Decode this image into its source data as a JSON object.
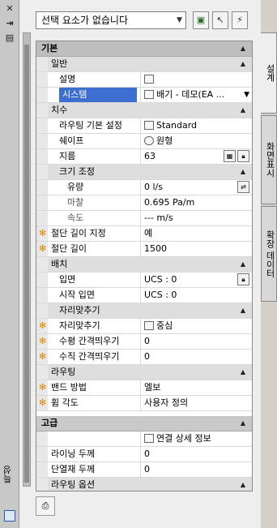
{
  "toolbar": {
    "selection": "선택 요소가 없습니다"
  },
  "side": {
    "title": "특성"
  },
  "tabs": [
    {
      "label": "설계"
    },
    {
      "label": "화면표시"
    },
    {
      "label": "확장 데이터"
    }
  ],
  "groups": {
    "basic": "기본",
    "general": "일반",
    "dimensions": "치수",
    "size_adjust": "크기 조정",
    "placement": "배치",
    "justification": "자리맞추기",
    "routing": "라우팅",
    "advanced": "고급",
    "routing_options": "라우팅 옵션"
  },
  "props": {
    "description": {
      "label": "설명",
      "value": ""
    },
    "system": {
      "label": "시스템",
      "value": "배기 - 데모(EA ..."
    },
    "routing_pref": {
      "label": "라우팅 기본 설정",
      "value": "Standard"
    },
    "shape": {
      "label": "쉐이프",
      "value": "원형"
    },
    "diameter": {
      "label": "지름",
      "value": "63"
    },
    "flow": {
      "label": "유량",
      "value": "0 l/s"
    },
    "friction": {
      "label": "마찰",
      "value": "0.695 Pa/m"
    },
    "velocity": {
      "label": "속도",
      "value": "--- m/s"
    },
    "cut_length_spec": {
      "label": "절단 길이 지정",
      "value": "예"
    },
    "cut_length": {
      "label": "절단 길이",
      "value": "1500"
    },
    "elevation": {
      "label": "입면",
      "value": "UCS : 0"
    },
    "start_elevation": {
      "label": "시작 입면",
      "value": "UCS : 0"
    },
    "justify": {
      "label": "자리맞추기",
      "value": "중심"
    },
    "h_offset": {
      "label": "수평 간격띄우기",
      "value": "0"
    },
    "v_offset": {
      "label": "수직 간격띄우기",
      "value": "0"
    },
    "bend_method": {
      "label": "밴드 방법",
      "value": "엘보"
    },
    "bend_angle": {
      "label": "휨 각도",
      "value": "사용자 정의"
    },
    "connection_detail": {
      "label": "",
      "value": "연결 상세 정보"
    },
    "lining": {
      "label": "라이닝 두께",
      "value": "0"
    },
    "insulation": {
      "label": "단열재 두께",
      "value": "0"
    }
  },
  "colors": {
    "selection": "#3d6fd0",
    "asterisk": "#e08a00"
  }
}
